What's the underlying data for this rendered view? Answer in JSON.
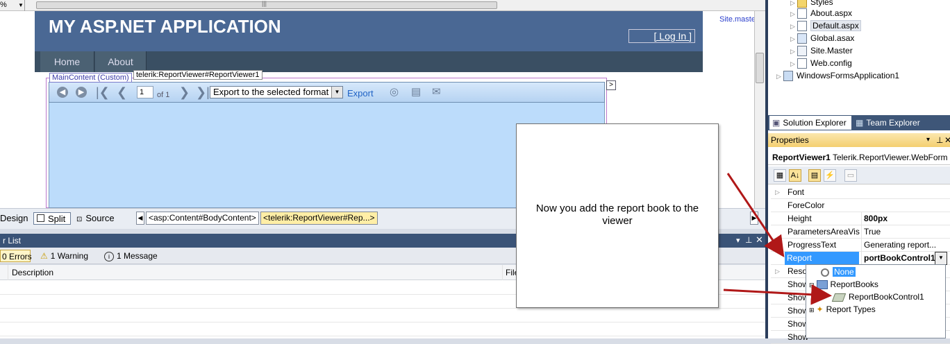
{
  "designer": {
    "zoom_label": "%",
    "scroll_mark": "|||",
    "site_title": "MY ASP.NET APPLICATION",
    "login_link": "[ Log In ]",
    "site_master_link": "Site.master",
    "menu": [
      "Home",
      "About"
    ],
    "main_content_tag": "MainContent (Custom)",
    "viewer_tag": "telerik:ReportViewer#ReportViewer1",
    "viewer_toolbar": {
      "page_value": "1",
      "page_of": "of 1",
      "export_select": "Export to the selected format",
      "export_link": "Export"
    },
    "smart_tag": ">"
  },
  "view_bar": {
    "design": "Design",
    "split": "Split",
    "source": "Source",
    "crumb_nav": "◀",
    "crumbs": [
      "<asp:Content#BodyContent>",
      "<telerik:ReportViewer#Rep...>"
    ],
    "right_arrow": "▶"
  },
  "error_list": {
    "title": "r List",
    "errors": "0 Errors",
    "warnings": "1 Warning",
    "messages": "1 Message",
    "col_description": "Description",
    "col_file": "File"
  },
  "solution_tree": {
    "items": [
      {
        "label": "Styles",
        "icon": "folder-icon"
      },
      {
        "label": "About.aspx",
        "icon": "aspx-file-icon"
      },
      {
        "label": "Default.aspx",
        "icon": "aspx-file-icon"
      },
      {
        "label": "Global.asax",
        "icon": "asax-file-icon"
      },
      {
        "label": "Site.Master",
        "icon": "master-file-icon"
      },
      {
        "label": "Web.config",
        "icon": "config-file-icon"
      },
      {
        "label": "WindowsFormsApplication1",
        "icon": "project-icon"
      }
    ]
  },
  "tabs": {
    "solution_explorer": "Solution Explorer",
    "team_explorer": "Team Explorer"
  },
  "properties": {
    "title": "Properties",
    "object_name": "ReportViewer1",
    "object_type": "Telerik.ReportViewer.WebForm",
    "rows": [
      {
        "name": "Font",
        "value": "",
        "expandable": true
      },
      {
        "name": "ForeColor",
        "value": ""
      },
      {
        "name": "Height",
        "value": "800px"
      },
      {
        "name": "ParametersAreaVisit",
        "value": "True"
      },
      {
        "name": "ProgressText",
        "value": "Generating report..."
      },
      {
        "name": "Report",
        "value": "portBookControl1"
      },
      {
        "name": "Reso",
        "value": "",
        "expandable": true
      },
      {
        "name": "Show",
        "value": ""
      },
      {
        "name": "Show",
        "value": ""
      },
      {
        "name": "Show",
        "value": ""
      },
      {
        "name": "Show",
        "value": ""
      },
      {
        "name": "Show",
        "value": ""
      }
    ],
    "dropdown": {
      "none": "None",
      "report_books": "ReportBooks",
      "report_book_control": "ReportBookControl1",
      "report_types": "Report Types"
    }
  },
  "callout": {
    "text": "Now you add the report book to the viewer"
  },
  "colors": {
    "arrow": "#b01818",
    "selection": "#3399ff",
    "header_blue": "#4a6894"
  }
}
